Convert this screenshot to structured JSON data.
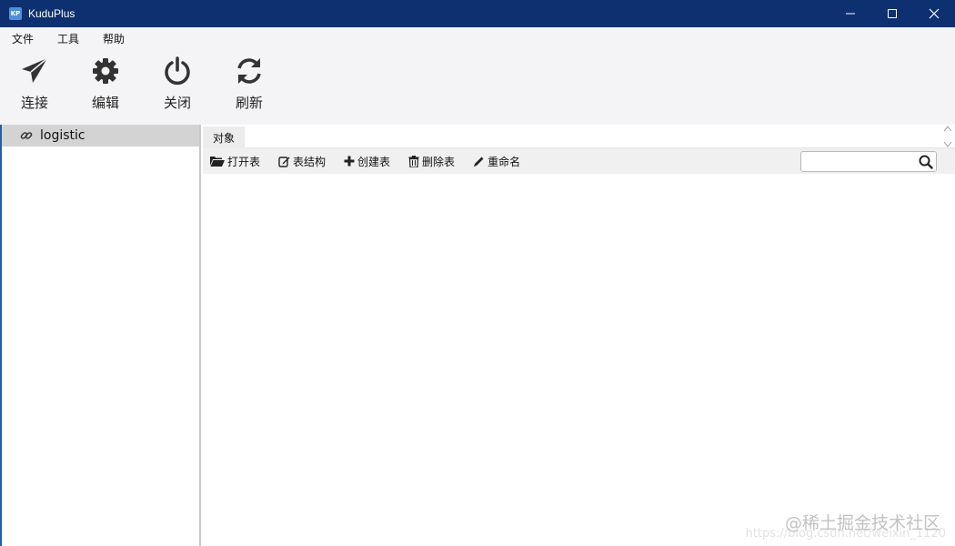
{
  "window": {
    "title": "KuduPlus",
    "logo_text": "KP"
  },
  "menu": {
    "items": [
      "文件",
      "工具",
      "帮助"
    ]
  },
  "toolbar": {
    "connect": "连接",
    "edit": "编辑",
    "close": "关闭",
    "refresh": "刷新"
  },
  "tree": {
    "items": [
      {
        "label": "logistic",
        "icon": "link-icon"
      }
    ]
  },
  "tabs": {
    "objects": "对象"
  },
  "object_toolbar": {
    "open_table": "打开表",
    "table_structure": "表结构",
    "create_table": "创建表",
    "delete_table": "删除表",
    "rename": "重命名"
  },
  "search": {
    "value": "",
    "placeholder": ""
  },
  "watermark": {
    "text": "@稀土掘金技术社区",
    "url": "https://blog.csdn.net/weixin_1120"
  },
  "colors": {
    "titlebar": "#0d3070",
    "toolbar_bg": "#f4f4f6",
    "selected_tree_bg": "#d3d3d3"
  }
}
